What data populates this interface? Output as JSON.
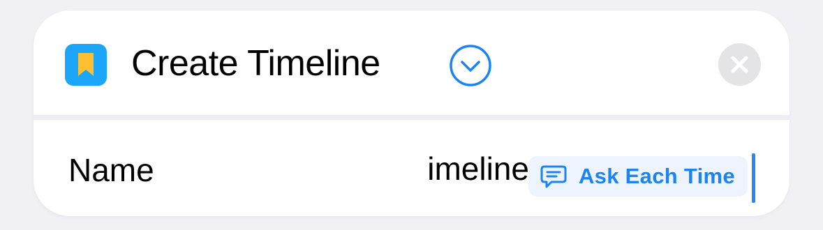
{
  "action": {
    "title": "Create Timeline",
    "app_icon": "bookmark-icon",
    "expand_icon": "chevron-down-circle-icon",
    "close_icon": "close-icon"
  },
  "parameter": {
    "label": "Name",
    "value_visible": "imeline",
    "variable_token": {
      "icon": "speech-bubble-icon",
      "label": "Ask Each Time"
    }
  },
  "colors": {
    "accent": "#1B84F4",
    "app_icon_background": "#1BA6F9",
    "bookmark": "#FDC032",
    "background": "#F0F0F5",
    "card": "#FFFFFF",
    "token_background": "#EDF4FD",
    "close_button": "#E4E4E6"
  }
}
